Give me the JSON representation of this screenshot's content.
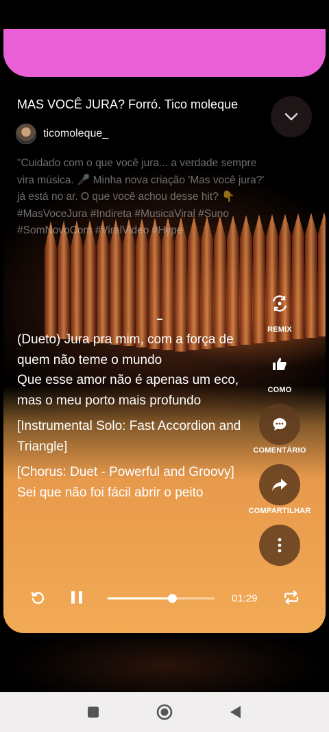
{
  "song": {
    "title": "MAS VOCÊ JURA?  Forró. Tico moleque",
    "author": "ticomoleque_",
    "description": "\"Cuidado com o que você jura... a verdade sempre vira música. 🎤 Minha nova criação 'Mas você jura?' já está no ar. O que você achou desse hit? 👇 #MasVoceJura #Indireta #MusicaViral #Suno #SomNovoCom #ViralVideo #Hype"
  },
  "lyrics": [
    "(Dueto) Jura pra mim, com a força de quem não teme o mundo",
    "Que esse amor não é apenas um eco, mas o meu porto mais profundo",
    "[Instrumental Solo: Fast Accordion and Triangle]",
    "[Chorus: Duet - Powerful and Groovy]",
    "Sei que não foi fácil abrir o peito"
  ],
  "actions": {
    "remix": "REMIX",
    "like": "COMO",
    "comment": "COMENTÁRIO",
    "share": "COMPARTILHAR"
  },
  "player": {
    "elapsed": "01:29",
    "progress": 0.6
  },
  "icons": {
    "collapse": "chevron-down-icon",
    "remix": "remix-icon",
    "like": "thumbs-up-icon",
    "comment": "comment-icon",
    "share": "share-arrow-icon",
    "more": "more-vertical-icon",
    "restart": "replay-icon",
    "pause": "pause-icon",
    "repeat": "repeat-icon"
  },
  "colors": {
    "accent_pink": "#e85fd6",
    "lyrics_bg_orange": "#f2aa55",
    "action_btn": "#5f3c1e"
  }
}
